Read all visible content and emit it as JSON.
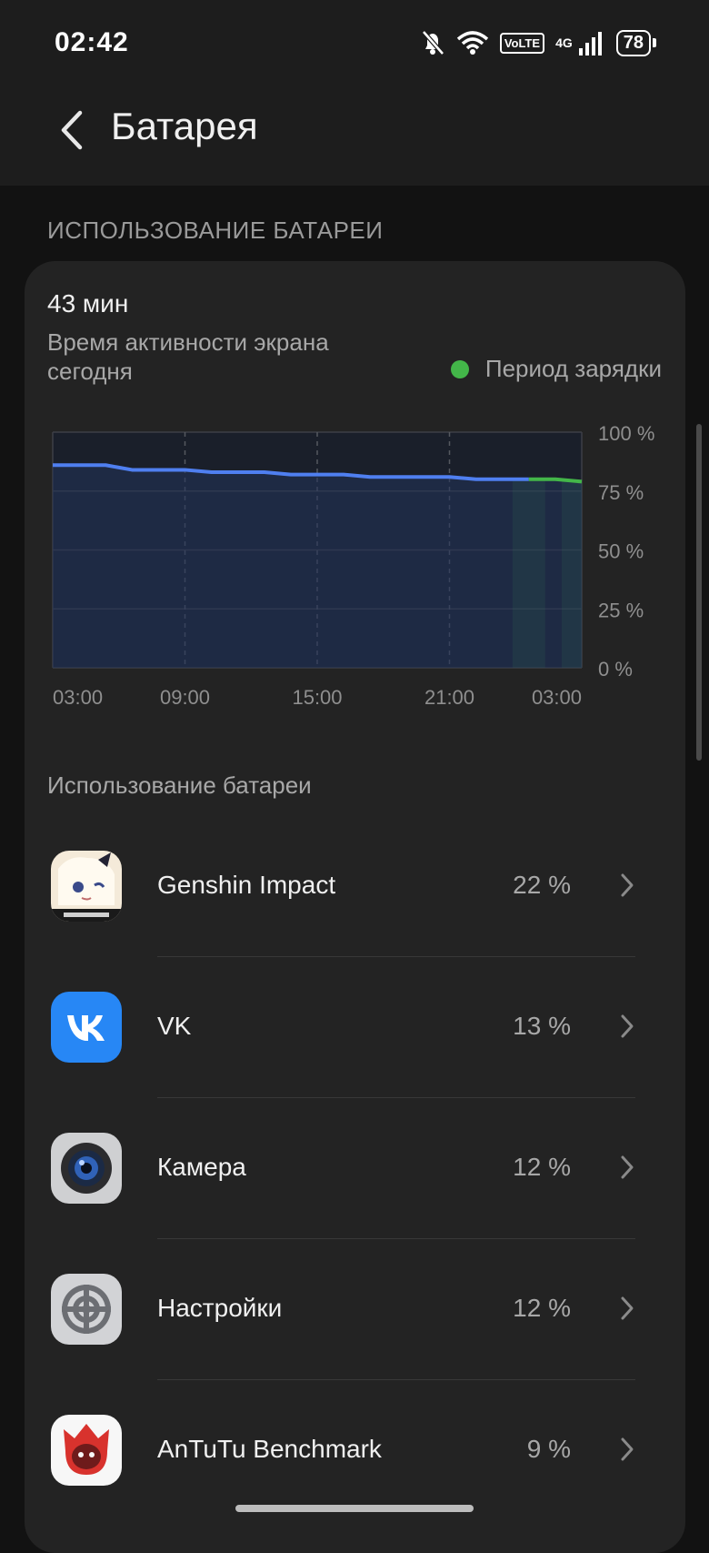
{
  "status_bar": {
    "time": "02:42",
    "volte": "VoLTE",
    "network": "4G",
    "battery": "78",
    "icons": [
      "bell-off-icon",
      "wifi-icon",
      "signal-icon",
      "battery-icon"
    ]
  },
  "header": {
    "title": "Батарея",
    "back_icon": "chevron-left-icon"
  },
  "section": {
    "title": "ИСПОЛЬЗОВАНИЕ БАТАРЕИ"
  },
  "summary": {
    "screen_time": "43 мин",
    "screen_time_label": "Время активности экрана сегодня",
    "legend_label": "Период зарядки",
    "legend_color": "#43b649"
  },
  "chart_data": {
    "type": "line",
    "series": [
      {
        "values": [
          86,
          86,
          86,
          84,
          84,
          84,
          83,
          83,
          83,
          82,
          82,
          82,
          81,
          81,
          81,
          81,
          80,
          80,
          80,
          80,
          79
        ]
      }
    ],
    "x_ticks": [
      "03:00",
      "09:00",
      "15:00",
      "21:00",
      "03:00"
    ],
    "y_ticks": [
      "100 %",
      "75 %",
      "50 %",
      "25 %",
      "0 %"
    ],
    "ylim": [
      0,
      100
    ],
    "charging_color": "#43b649",
    "line_color": "#4f7ff0",
    "grid": true
  },
  "usage": {
    "title": "Использование батареи",
    "apps": [
      {
        "name": "Genshin Impact",
        "percent": "22 %",
        "icon": "genshin-impact-icon"
      },
      {
        "name": "VK",
        "percent": "13 %",
        "icon": "vk-icon"
      },
      {
        "name": "Камера",
        "percent": "12 %",
        "icon": "camera-icon"
      },
      {
        "name": "Настройки",
        "percent": "12 %",
        "icon": "settings-icon"
      },
      {
        "name": "AnTuTu Benchmark",
        "percent": "9 %",
        "icon": "antutu-icon"
      }
    ]
  }
}
